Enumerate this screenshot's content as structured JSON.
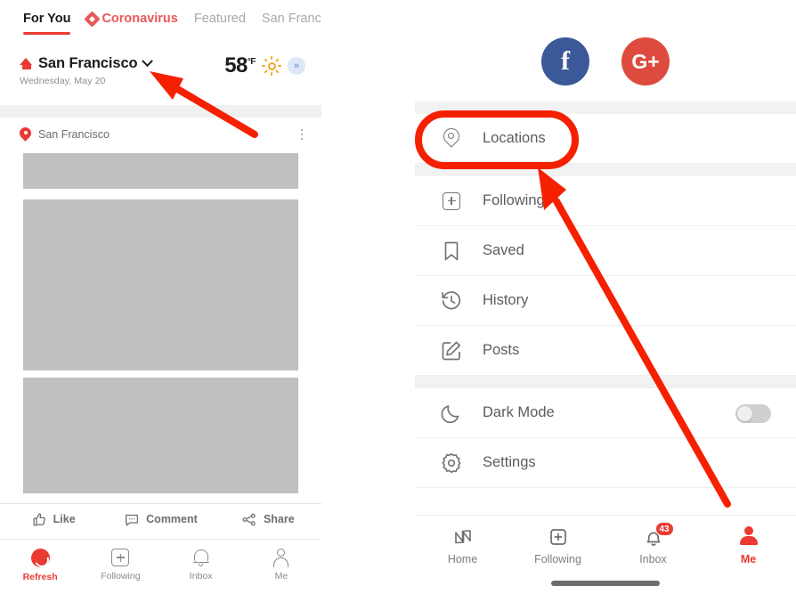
{
  "left_panel": {
    "tabs": [
      {
        "label": "For You",
        "state": "active",
        "icon": null
      },
      {
        "label": "Coronavirus",
        "state": "highlight",
        "icon": "diamond-icon"
      },
      {
        "label": "Featured",
        "state": "muted",
        "icon": null
      },
      {
        "label": "San Francis",
        "state": "muted",
        "icon": null
      }
    ],
    "weather": {
      "home_icon": "home-icon",
      "city": "San Francisco",
      "chevron": "chevron-down-icon",
      "date": "Wednesday, May 20",
      "temperature": "58",
      "unit": "°F",
      "condition_icon": "sun-icon",
      "expand_icon": "»"
    },
    "card": {
      "pin_icon": "location-pin-icon",
      "title": "San Francisco",
      "menu_icon": "kebab-menu-icon",
      "placeholder_color": "#c0c0c0"
    },
    "actions": [
      {
        "label": "Like",
        "icon": "thumbs-up-icon"
      },
      {
        "label": "Comment",
        "icon": "comment-bubble-icon"
      },
      {
        "label": "Share",
        "icon": "share-nodes-icon"
      }
    ],
    "bottom_nav": [
      {
        "label": "Refresh",
        "icon": "refresh-icon",
        "active": true
      },
      {
        "label": "Following",
        "icon": "plus-box-icon",
        "active": false
      },
      {
        "label": "Inbox",
        "icon": "bell-icon",
        "active": false
      },
      {
        "label": "Me",
        "icon": "person-icon",
        "active": false
      }
    ]
  },
  "right_panel": {
    "social": [
      {
        "label": "f",
        "name": "facebook-login-button",
        "color": "#3b5998"
      },
      {
        "label": "G+",
        "name": "google-plus-login-button",
        "color": "#dd4b3e"
      }
    ],
    "menu_group_1": [
      {
        "label": "Locations",
        "icon": "location-pin-icon",
        "highlighted": true
      }
    ],
    "menu_group_2": [
      {
        "label": "Following",
        "icon": "plus-box-icon"
      },
      {
        "label": "Saved",
        "icon": "bookmark-icon"
      },
      {
        "label": "History",
        "icon": "history-clock-icon"
      },
      {
        "label": "Posts",
        "icon": "edit-square-icon"
      }
    ],
    "menu_group_3": [
      {
        "label": "Dark Mode",
        "icon": "moon-icon",
        "toggle": "off"
      },
      {
        "label": "Settings",
        "icon": "gear-icon"
      }
    ],
    "bottom_nav": [
      {
        "label": "Home",
        "icon": "newsbreak-logo-icon",
        "active": false,
        "badge": null
      },
      {
        "label": "Following",
        "icon": "plus-box-icon",
        "active": false,
        "badge": null
      },
      {
        "label": "Inbox",
        "icon": "bell-icon",
        "active": false,
        "badge": "43"
      },
      {
        "label": "Me",
        "icon": "person-filled-icon",
        "active": true,
        "badge": null
      }
    ]
  },
  "annotations": {
    "accent_color": "#f52000",
    "left_arrow": "arrow pointing to city dropdown",
    "right_arrow": "arrow from Me tab to Locations row",
    "oval": "red oval around Locations row"
  }
}
